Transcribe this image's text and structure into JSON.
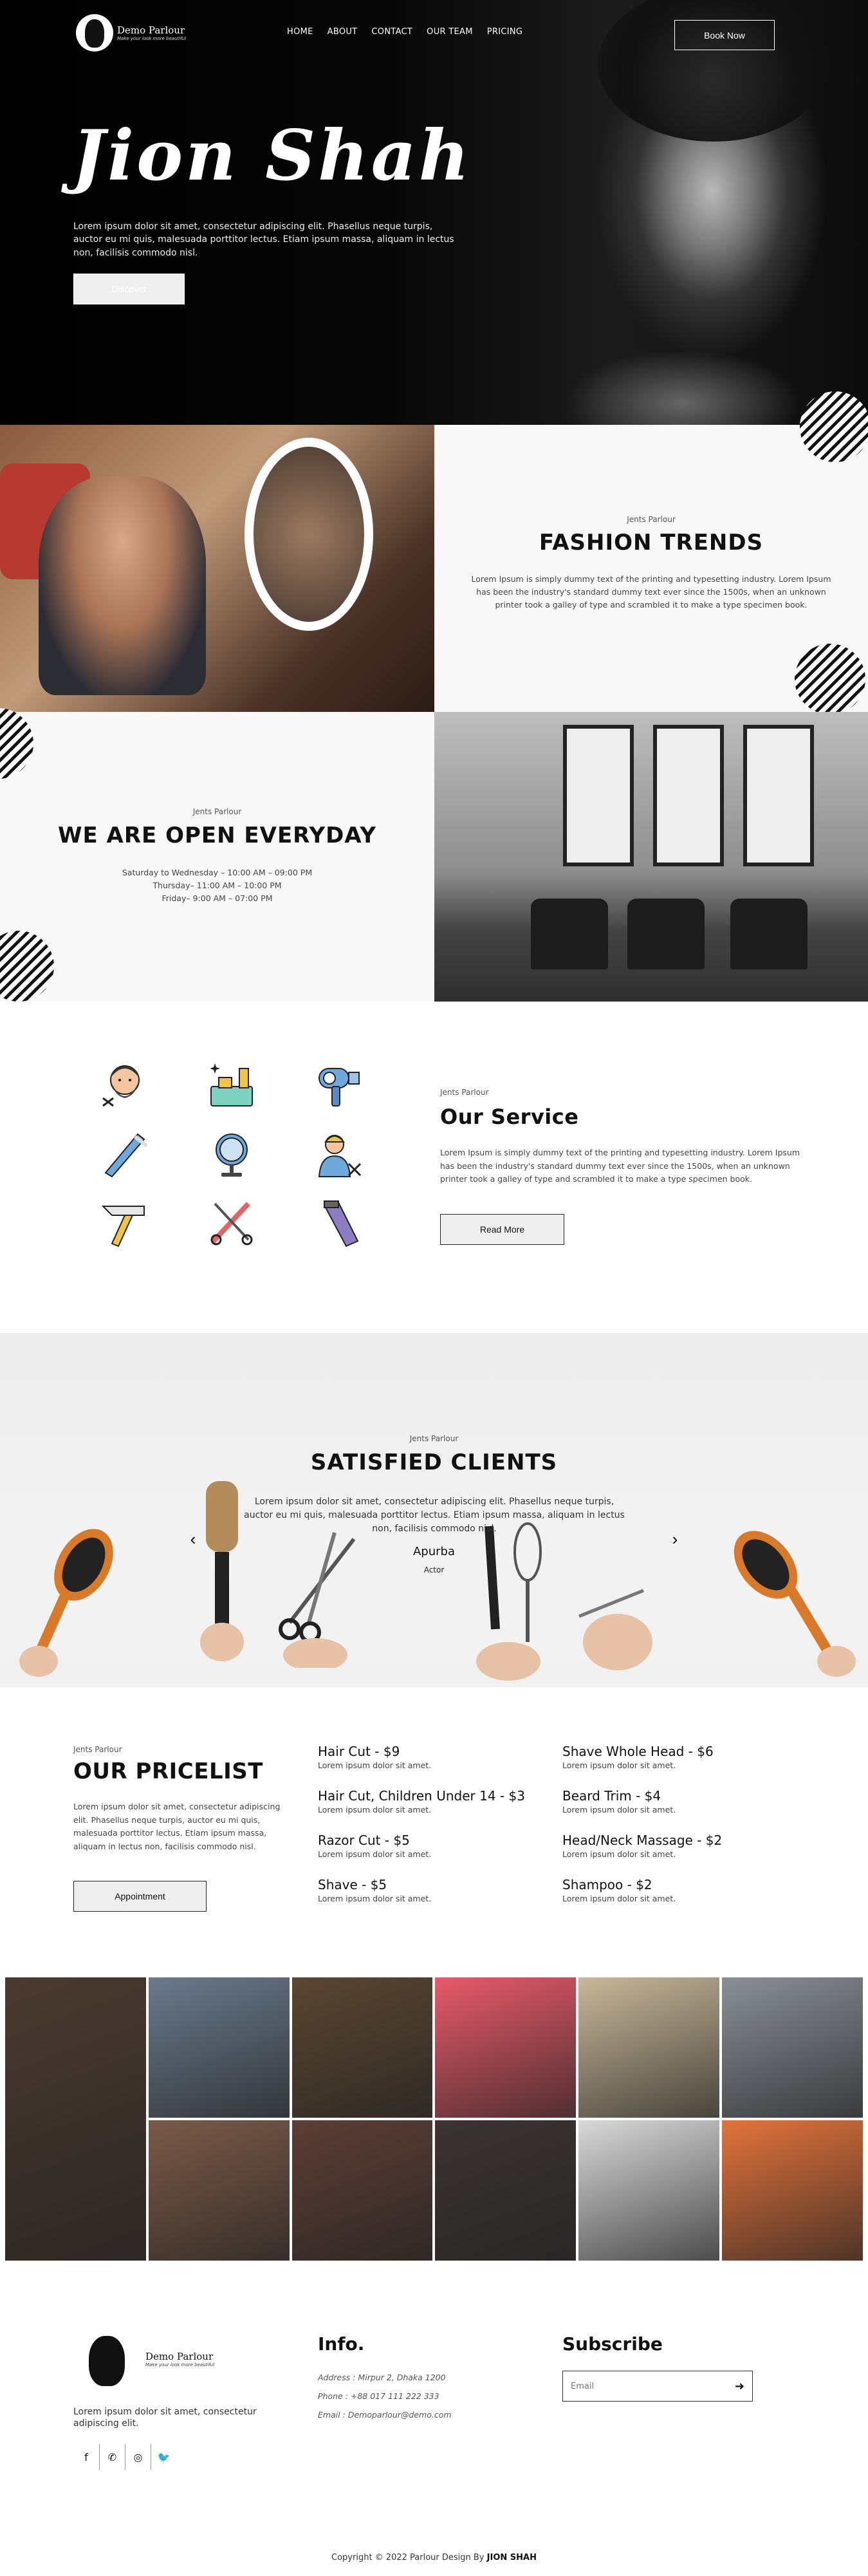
{
  "brand": {
    "name": "Demo Parlour",
    "tagline": "Make your look more beautiful"
  },
  "nav": {
    "items": [
      "HOME",
      "ABOUT",
      "CONTACT",
      "OUR TEAM",
      "PRICING"
    ],
    "book_label": "Book Now"
  },
  "hero": {
    "title": "Jion Shah",
    "text": "Lorem ipsum dolor sit amet, consectetur adipiscing elit. Phasellus neque turpis, auctor eu mi quis, malesuada porttitor lectus. Etiam ipsum massa, aliquam in lectus non, facilisis commodo nisl.",
    "button": "Discover"
  },
  "fashion": {
    "kicker": "Jents Parlour",
    "title": "FASHION TRENDS",
    "body": "Lorem Ipsum is simply dummy text of the printing and typesetting industry. Lorem Ipsum has been the industry's standard dummy text ever since the 1500s, when an unknown printer took a galley of type and scrambled it to make a type specimen book."
  },
  "open": {
    "kicker": "Jents Parlour",
    "title": "WE ARE OPEN EVERYDAY",
    "hours": [
      "Saturday to Wednesday – 10:00 AM – 09:00 PM",
      "Thursday– 11:00 AM – 10:00 PM",
      "Friday– 9:00 AM – 07:00 PM"
    ]
  },
  "service": {
    "kicker": "Jents Parlour",
    "title": "Our Service",
    "body": "Lorem Ipsum is simply dummy text of the printing and typesetting industry. Lorem Ipsum has been the industry's standard dummy text ever since the 1500s, when an unknown printer took a galley of type and scrambled it to make a type specimen book.",
    "button": "Read More",
    "icons": [
      "beard-man-icon",
      "cosmetics-icon",
      "hair-dryer-icon",
      "razor-icon",
      "mirror-icon",
      "barber-icon",
      "straight-razor-icon",
      "comb-scissors-icon",
      "hair-clipper-icon"
    ]
  },
  "clients": {
    "kicker": "Jents Parlour",
    "title": "SATISFIED CLIENTS",
    "quote": "Lorem ipsum dolor sit amet, consectetur adipiscing elit. Phasellus neque turpis, auctor eu mi quis, malesuada porttitor lectus. Etiam ipsum massa, aliquam in lectus non, facilisis commodo nisl.",
    "name": "Apurba",
    "role": "Actor",
    "prev": "‹",
    "next": "›"
  },
  "pricelist": {
    "kicker": "Jents Parlour",
    "title": "OUR PRICELIST",
    "body": "Lorem ipsum dolor sit amet, consectetur adipiscing elit. Phasellus neque turpis, auctor eu mi quis, malesuada porttitor lectus. Etiam ipsum massa, aliquam in lectus non, facilisis commodo nisl.",
    "button": "Appointment",
    "items": [
      {
        "name": "Hair Cut - $9",
        "desc": "Lorem ipsum dolor sit amet."
      },
      {
        "name": "Hair Cut, Children Under 14 - $3",
        "desc": "Lorem ipsum dolor sit amet."
      },
      {
        "name": "Razor Cut - $5",
        "desc": "Lorem ipsum dolor sit amet."
      },
      {
        "name": "Shave - $5",
        "desc": "Lorem ipsum dolor sit amet."
      },
      {
        "name": "Shave Whole Head - $6",
        "desc": "Lorem ipsum dolor sit amet."
      },
      {
        "name": "Beard Trim - $4",
        "desc": "Lorem ipsum dolor sit amet."
      },
      {
        "name": "Head/Neck Massage - $2",
        "desc": "Lorem ipsum dolor sit amet."
      },
      {
        "name": "Shampoo - $2",
        "desc": "Lorem ipsum dolor sit amet."
      }
    ]
  },
  "gallery": {
    "colors": [
      "#4a3a30",
      "#6b7a8c",
      "#5a4632",
      "#e85a6a",
      "#c8b89a",
      "#8a8f97",
      "#7a5a48",
      "#5c3e36",
      "#3c3434",
      "#d9d9d9",
      "#e2733c",
      "#a2c94a"
    ]
  },
  "footer": {
    "about": "Lorem ipsum dolor sit amet, consectetur adipiscing elit.",
    "social": [
      "f",
      "✆",
      "◎",
      "🐦"
    ],
    "info_title": "Info.",
    "address": "Address : Mirpur 2, Dhaka 1200",
    "phone": "Phone : +88 017 111 222 333",
    "email": "Email : Demoparlour@demo.com",
    "subscribe_title": "Subscribe",
    "subscribe_placeholder": "Email",
    "copyright_prefix": "Copyright © 2022 Parlour Design By",
    "copyright_author": "JION SHAH"
  }
}
